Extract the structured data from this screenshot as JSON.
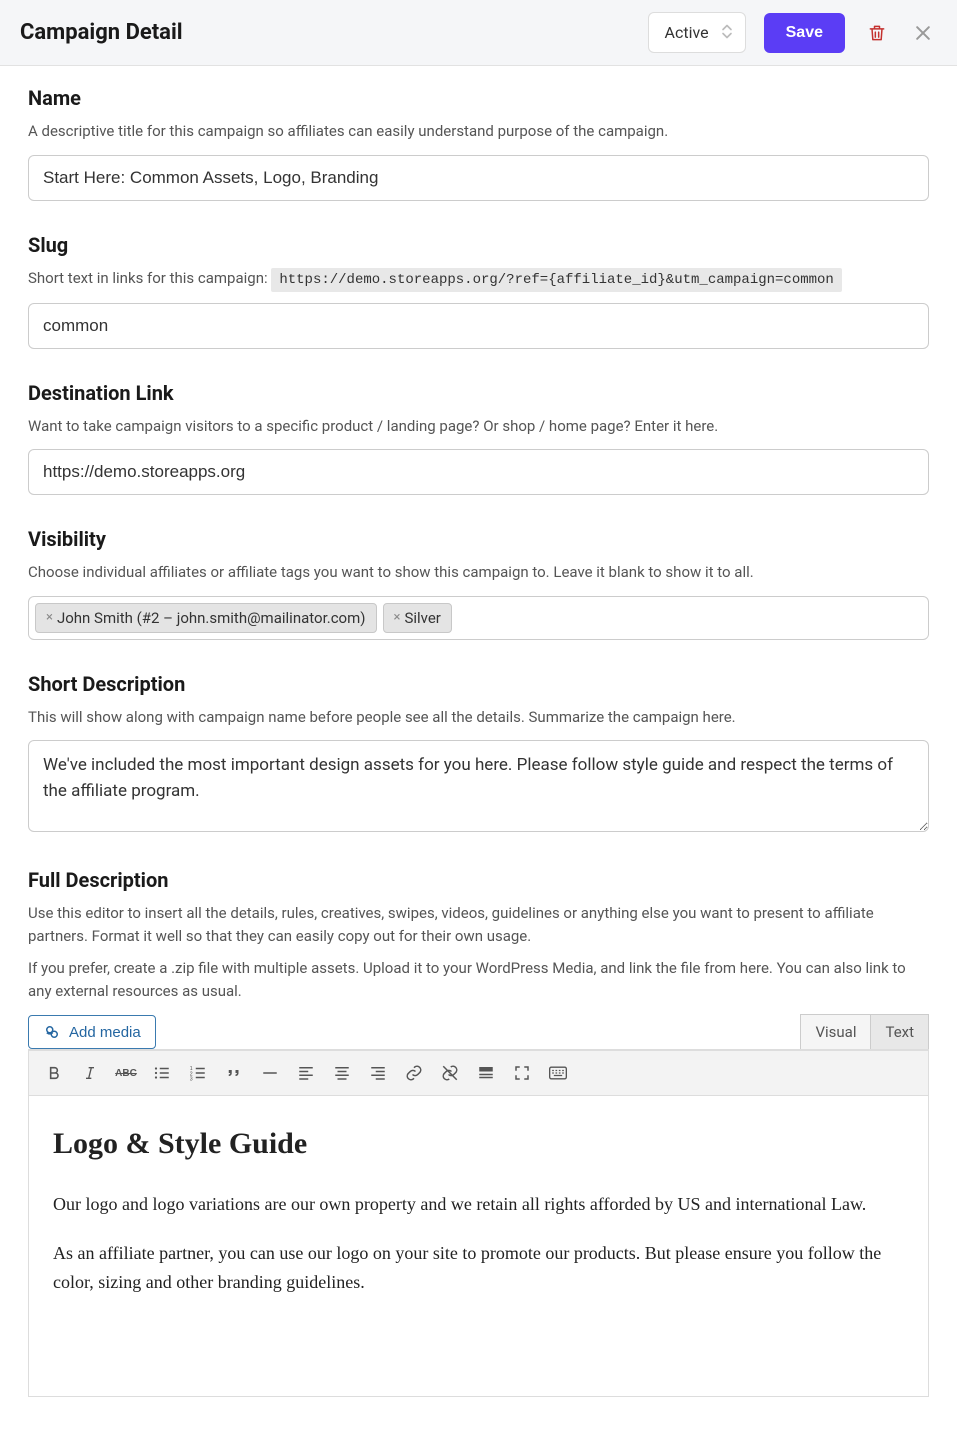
{
  "header": {
    "title": "Campaign Detail",
    "status_selected": "Active",
    "save_label": "Save"
  },
  "name": {
    "label": "Name",
    "help": "A descriptive title for this campaign so affiliates can easily understand purpose of the campaign.",
    "value": "Start Here: Common Assets, Logo, Branding"
  },
  "slug": {
    "label": "Slug",
    "help_prefix": "Short text in links for this campaign: ",
    "url_preview": "https://demo.storeapps.org/?ref={affiliate_id}&utm_campaign=common",
    "value": "common"
  },
  "destination": {
    "label": "Destination Link",
    "help": "Want to take campaign visitors to a specific product / landing page? Or shop / home page? Enter it here.",
    "value": "https://demo.storeapps.org"
  },
  "visibility": {
    "label": "Visibility",
    "help": "Choose individual affiliates or affiliate tags you want to show this campaign to. Leave it blank to show it to all.",
    "tags": [
      "John Smith (#2 – john.smith@mailinator.com)",
      "Silver"
    ]
  },
  "short_desc": {
    "label": "Short Description",
    "help": "This will show along with campaign name before people see all the details. Summarize the campaign here.",
    "value": "We've included the most important design assets for you here. Please follow style guide and respect the terms of the affiliate program."
  },
  "full_desc": {
    "label": "Full Description",
    "help1": "Use this editor to insert all the details, rules, creatives, swipes, videos, guidelines or anything else you want to present to affiliate partners. Format it well so that they can easily copy out for their own usage.",
    "help2": "If you prefer, create a .zip file with multiple assets. Upload it to your WordPress Media, and link the file from here. You can also link to any external resources as usual.",
    "add_media_label": "Add media",
    "tabs": {
      "visual": "Visual",
      "text": "Text"
    },
    "content_heading": "Logo & Style Guide",
    "content_p1": "Our logo and logo variations are our own property and we retain all rights afforded by US and international Law.",
    "content_p2": "As an affiliate partner, you can use our logo on your site to promote our products. But please ensure you follow the color, sizing and other branding guidelines."
  }
}
